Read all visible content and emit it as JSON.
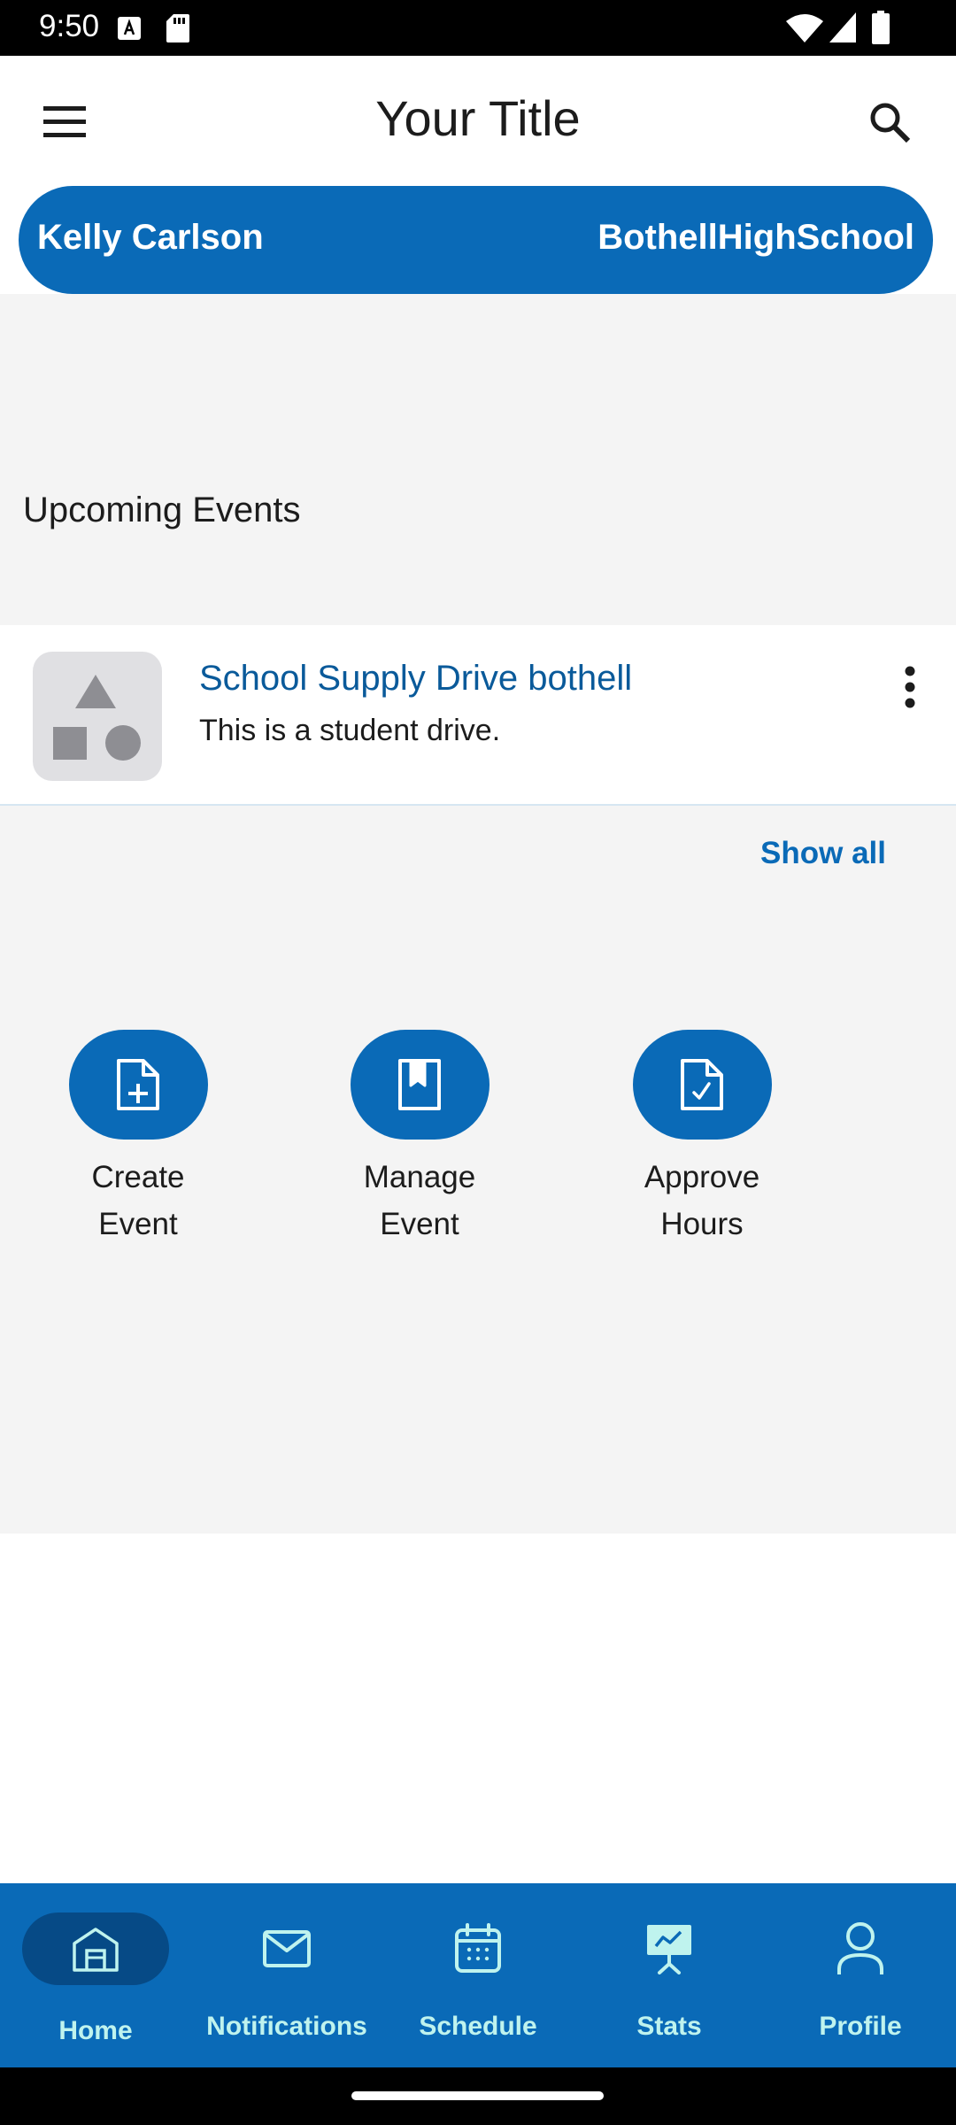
{
  "status_bar": {
    "time": "9:50"
  },
  "app_bar": {
    "title": "Your Title"
  },
  "user": {
    "name": "Kelly Carlson",
    "school": "BothellHighSchool"
  },
  "upcoming": {
    "section_title": "Upcoming Events",
    "events": [
      {
        "title": "School Supply Drive bothell",
        "description": "This is a student drive."
      }
    ],
    "show_all_label": "Show all"
  },
  "actions": [
    {
      "line1": "Create",
      "line2": "Event"
    },
    {
      "line1": "Manage",
      "line2": "Event"
    },
    {
      "line1": "Approve",
      "line2": "Hours"
    }
  ],
  "bottom_nav": {
    "items": [
      {
        "label": "Home",
        "icon": "home-icon",
        "active": true
      },
      {
        "label": "Notifications",
        "icon": "mail-icon",
        "active": false
      },
      {
        "label": "Schedule",
        "icon": "calendar-icon",
        "active": false
      },
      {
        "label": "Stats",
        "icon": "stats-icon",
        "active": false
      },
      {
        "label": "Profile",
        "icon": "person-icon",
        "active": false
      }
    ]
  },
  "colors": {
    "primary": "#0a6ab7",
    "nav_label": "#bff3ee",
    "event_title": "#0a5a9a",
    "content_bg": "#f4f4f4"
  }
}
